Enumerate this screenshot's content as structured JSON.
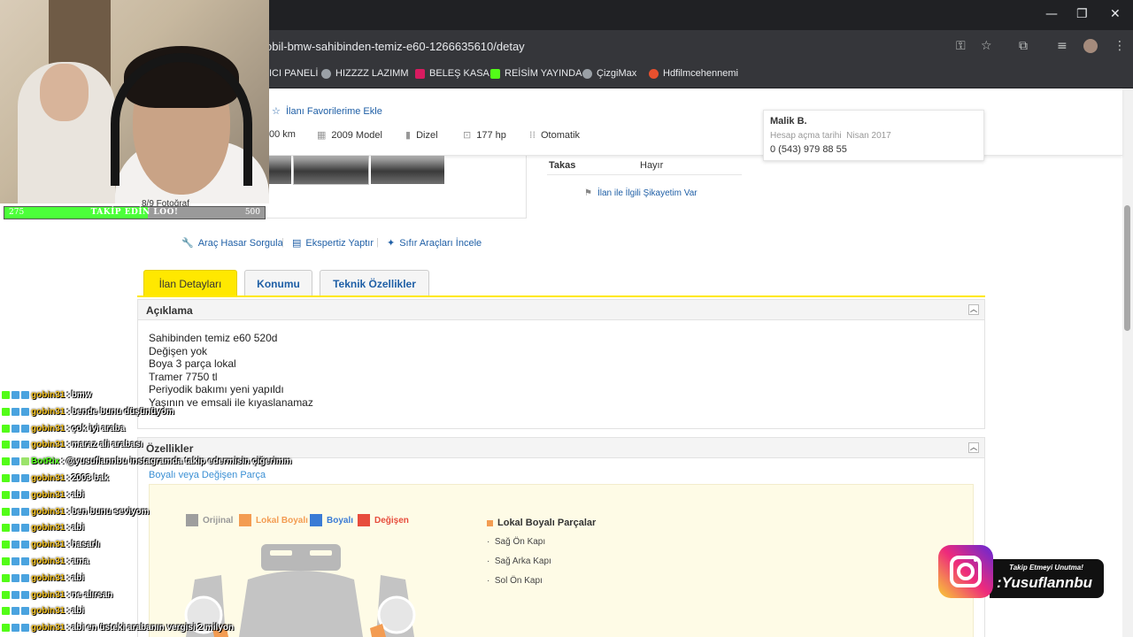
{
  "browser": {
    "url": "obil-bmw-sahibinden-temiz-e60-1266635610/detay",
    "window_controls": [
      "—",
      "❐",
      "✕"
    ],
    "bookmarks": [
      {
        "label": "ICI PANELİ",
        "color": "#35363a"
      },
      {
        "label": "HIZZZZ LAZIMM",
        "color": "#9aa0a6"
      },
      {
        "label": "BELEŞ KASA",
        "color": "#d81b60"
      },
      {
        "label": "REİSİM YAYINDA",
        "color": "#53fc18"
      },
      {
        "label": "ÇizgiMax",
        "color": "#9aa0a6"
      },
      {
        "label": "Hdfilmcehennemi",
        "color": "#e8502e"
      }
    ]
  },
  "listing": {
    "favorite_label": "İlanı Favorilerime Ekle",
    "specs": [
      {
        "icon": "road-icon",
        "label": "00 km"
      },
      {
        "icon": "calendar-icon",
        "label": "2009 Model"
      },
      {
        "icon": "fuel-icon",
        "label": "Dizel"
      },
      {
        "icon": "engine-icon",
        "label": "177 hp"
      },
      {
        "icon": "gearbox-icon",
        "label": "Otomatik"
      }
    ],
    "takas_label": "Takas",
    "takas_value": "Hayır",
    "report_label": "İlan ile İlgili Şikayetim Var",
    "photo_count": "8/9 Fotoğraf"
  },
  "seller": {
    "name": "Malik B.",
    "since_label": "Hesap açma tarihi",
    "since_value": "Nisan 2017",
    "phone": "0 (543) 979 88 55"
  },
  "tools": [
    "Araç Hasar Sorgula",
    "Ekspertiz Yaptır",
    "Sıfır Araçları İncele"
  ],
  "tabs": [
    "İlan Detayları",
    "Konumu",
    "Teknik Özellikler"
  ],
  "description": {
    "title": "Açıklama",
    "lines": [
      "Sahibinden temiz  e60 520d",
      "Değişen yok",
      "Boya 3 parça lokal",
      "Tramer 7750 tl",
      "Periyodik bakımı yeni yapıldı",
      "Yaşının ve emsali ile kıyaslanamaz"
    ]
  },
  "features": {
    "title": "Özellikler",
    "section_title": "Boyalı veya Değişen Parça",
    "legend": [
      {
        "label": "Orijinal",
        "color": "#9e9e9e",
        "text_color": "#999999"
      },
      {
        "label": "Lokal Boyalı",
        "color": "#f39c52",
        "text_color": "#f39c52"
      },
      {
        "label": "Boyalı",
        "color": "#3a7bd5",
        "text_color": "#3a7bd5"
      },
      {
        "label": "Değişen",
        "color": "#e74c3c",
        "text_color": "#e74c3c"
      }
    ],
    "local_painted_title": "Lokal Boyalı Parçalar",
    "local_painted_parts": [
      "Sağ Ön Kapı",
      "Sağ Arka Kapı",
      "Sol Ön Kapı"
    ]
  },
  "stream": {
    "progress": {
      "current": "275",
      "goal": "500",
      "label": "TAKİP EDİN LOO!",
      "fraction": 0.55
    },
    "chat": [
      {
        "user": "gobin31",
        "msg": "bmw"
      },
      {
        "user": "gobin31",
        "msg": "bende bunu düşünüyom"
      },
      {
        "user": "gobin31",
        "msg": "çok iyi araba"
      },
      {
        "user": "gobin31",
        "msg": "maraz ali arabası"
      },
      {
        "user": "BotRix",
        "msg": "@yusuflannbu instagramda takip edermisin çiğerimm"
      },
      {
        "user": "gobin31",
        "msg": "2003 bak"
      },
      {
        "user": "gobin31",
        "msg": "abi"
      },
      {
        "user": "gobin31",
        "msg": "ben bunu seviyom"
      },
      {
        "user": "gobin31",
        "msg": "abi"
      },
      {
        "user": "gobin31",
        "msg": "hasarlı"
      },
      {
        "user": "gobin31",
        "msg": "ama"
      },
      {
        "user": "gobin31",
        "msg": "abi"
      },
      {
        "user": "gobin31",
        "msg": "ne alırsan"
      },
      {
        "user": "gobin31",
        "msg": "abi"
      },
      {
        "user": "gobin31",
        "msg": "abi en üsteki arabanın vergisi 2 milyon"
      }
    ],
    "instagram": {
      "tagline": "Takip Etmeyi Unutma!",
      "handle": ":Yusuflannbu"
    }
  }
}
